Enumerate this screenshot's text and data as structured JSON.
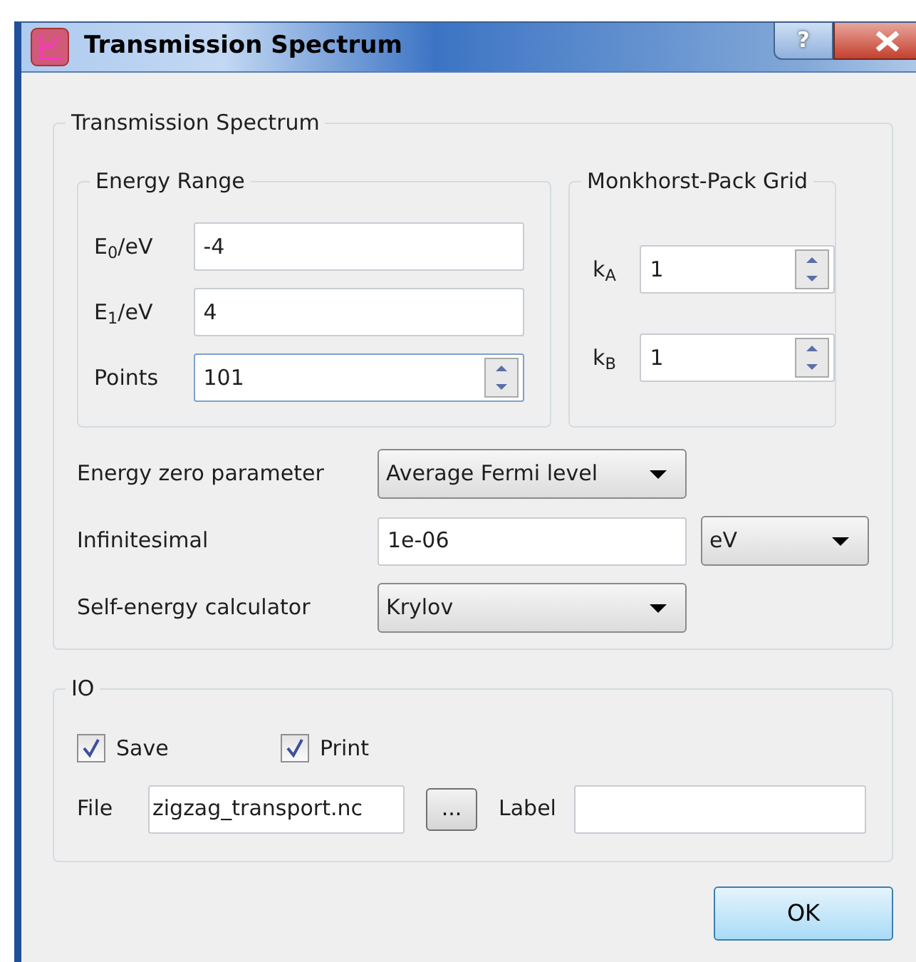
{
  "window": {
    "title": "Transmission Spectrum",
    "help_button": "?"
  },
  "transmission_group": {
    "title": "Transmission Spectrum",
    "energy_range": {
      "title": "Energy Range",
      "fields": [
        {
          "kind": "text",
          "label": "E$_{0}$/eV",
          "value": "-4"
        },
        {
          "kind": "text",
          "label": "E$_{1}$/eV",
          "value": "4"
        },
        {
          "kind": "spin",
          "label": "Points",
          "value": "101"
        }
      ]
    },
    "monkhorst_pack": {
      "title": "Monkhorst-Pack Grid",
      "fields": [
        {
          "kind": "spin",
          "label": "k$_{A}$",
          "value": "1"
        },
        {
          "kind": "spin",
          "label": "k$_{B}$",
          "value": "1"
        }
      ]
    },
    "energy_zero": {
      "label": "Energy zero parameter",
      "value": "Average Fermi level"
    },
    "infinitesimal": {
      "label": "Infinitesimal",
      "value": "1e-06",
      "unit": "eV"
    },
    "self_energy": {
      "label": "Self-energy calculator",
      "value": "Krylov"
    }
  },
  "io_group": {
    "title": "IO",
    "checkboxes": [
      {
        "label": "Save",
        "checked": true
      },
      {
        "label": "Print",
        "checked": true
      }
    ],
    "file": {
      "label": "File",
      "value": "zigzag_transport.nc",
      "browse": "..."
    },
    "label_field": {
      "label": "Label"
    }
  },
  "buttons": [
    "OK"
  ]
}
